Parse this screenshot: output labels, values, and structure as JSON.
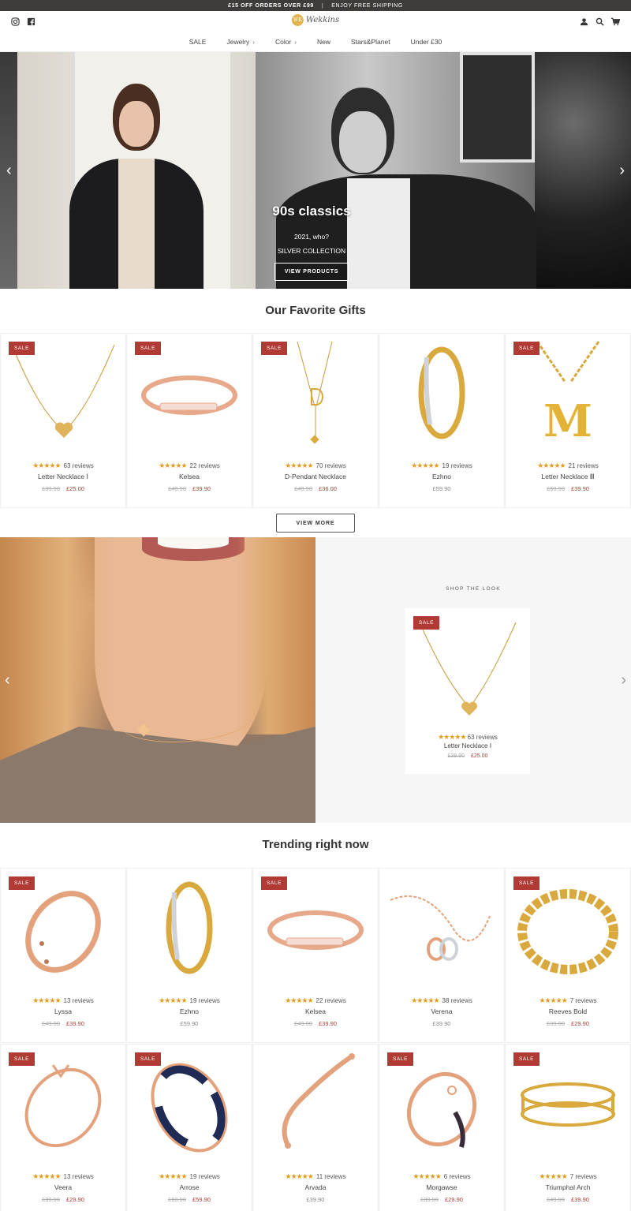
{
  "announcement": {
    "offer": "£15 OFF ORDERS OVER £99",
    "separator": "|",
    "shipping": "ENJOY FREE SHIPPING"
  },
  "header": {
    "logo_mark": "WK",
    "logo_text": "Wekkins"
  },
  "nav": [
    {
      "label": "SALE",
      "chevron": false
    },
    {
      "label": "Jewelry",
      "chevron": true
    },
    {
      "label": "Color",
      "chevron": true
    },
    {
      "label": "New",
      "chevron": false
    },
    {
      "label": "Stars&Planet",
      "chevron": false
    },
    {
      "label": "Under £30",
      "chevron": false
    }
  ],
  "hero": {
    "title": "90s classics",
    "subtitle": "2021, who?",
    "collection": "SILVER COLLECTION",
    "cta": "VIEW PRODUCTS"
  },
  "favorites": {
    "title": "Our Favorite Gifts",
    "view_more": "VIEW MORE",
    "products": [
      {
        "sale": true,
        "reviews": "63 reviews",
        "name": "Letter Necklace Ⅰ",
        "old_price": "£39.90",
        "price": "£25.00",
        "art": "heart-necklace"
      },
      {
        "sale": true,
        "reviews": "22 reviews",
        "name": "Kelsea",
        "old_price": "£49.90",
        "price": "£39.90",
        "art": "bangle-rose"
      },
      {
        "sale": true,
        "reviews": "70 reviews",
        "name": "D-Pendant Necklace",
        "old_price": "£49.90",
        "price": "£36.00",
        "art": "d-necklace"
      },
      {
        "sale": false,
        "reviews": "19 reviews",
        "name": "Ezhno",
        "old_price": "",
        "price": "£59.90",
        "art": "bangle-gold-crystal"
      },
      {
        "sale": true,
        "reviews": "21 reviews",
        "name": "Letter Necklace Ⅲ",
        "old_price": "£59.90",
        "price": "£39.90",
        "art": "m-necklace"
      }
    ]
  },
  "shop_the_look": {
    "kicker": "SHOP THE LOOK",
    "product": {
      "sale": true,
      "reviews": "63 reviews",
      "name": "Letter Necklace Ⅰ",
      "old_price": "£39.90",
      "price": "£25.00"
    }
  },
  "trending": {
    "title": "Trending right now",
    "products": [
      {
        "sale": true,
        "reviews": "13 reviews",
        "name": "Lyssa",
        "old_price": "£49.90",
        "price": "£39.90",
        "art": "bangle-rose-stones"
      },
      {
        "sale": false,
        "reviews": "19 reviews",
        "name": "Ezhno",
        "old_price": "",
        "price": "£59.90",
        "art": "bangle-gold-crystal"
      },
      {
        "sale": true,
        "reviews": "22 reviews",
        "name": "Kelsea",
        "old_price": "£49.90",
        "price": "£39.90",
        "art": "bangle-rose"
      },
      {
        "sale": false,
        "reviews": "38 reviews",
        "name": "Verena",
        "old_price": "",
        "price": "£39.90",
        "art": "chain-bracelet"
      },
      {
        "sale": true,
        "reviews": "7 reviews",
        "name": "Reeves Bold",
        "old_price": "£39.90",
        "price": "£29.90",
        "art": "curb-chain"
      },
      {
        "sale": true,
        "reviews": "13 reviews",
        "name": "Veera",
        "old_price": "£39.90",
        "price": "£29.90",
        "art": "bangle-thin"
      },
      {
        "sale": true,
        "reviews": "19 reviews",
        "name": "Arrose",
        "old_price": "£69.90",
        "price": "£59.90",
        "art": "bangle-navy"
      },
      {
        "sale": false,
        "reviews": "11 reviews",
        "name": "Arvada",
        "old_price": "",
        "price": "£39.90",
        "art": "cuff-rose"
      },
      {
        "sale": true,
        "reviews": "6 reviews",
        "name": "Morgawse",
        "old_price": "£39.90",
        "price": "£29.90",
        "art": "bangle-lock"
      },
      {
        "sale": true,
        "reviews": "7 reviews",
        "name": "Triumphal Arch",
        "old_price": "£49.90",
        "price": "£39.90",
        "art": "cuff-gold"
      }
    ]
  },
  "labels": {
    "sale": "SALE",
    "stars": "★★★★★"
  },
  "colors": {
    "sale_badge": "#b23a34",
    "star": "#e69b1f",
    "announce_bg": "#3f3b3b",
    "gold": "#d9a93d",
    "rose": "#e3a27c"
  }
}
